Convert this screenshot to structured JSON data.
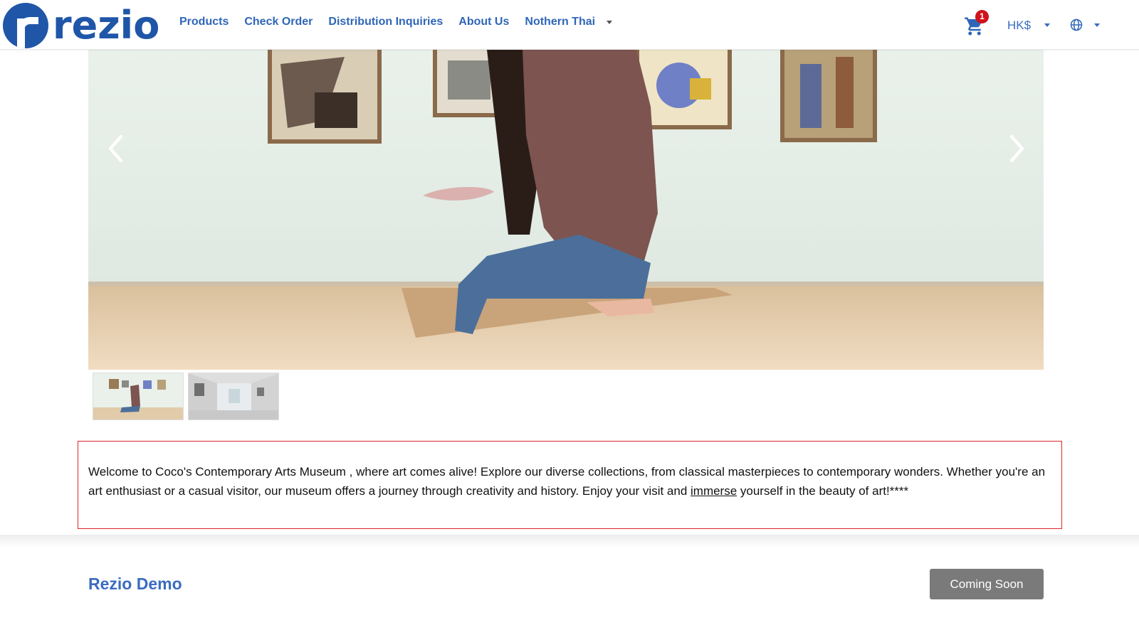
{
  "brand": {
    "name": "rezio",
    "color": "#1f56a8"
  },
  "nav": {
    "items": [
      {
        "label": "Products"
      },
      {
        "label": "Check Order"
      },
      {
        "label": "Distribution Inquiries"
      },
      {
        "label": "About Us"
      },
      {
        "label": "Nothern Thai"
      }
    ]
  },
  "header": {
    "cart_icon": "cart-icon",
    "cart_count": "1",
    "currency": "HK$",
    "language_icon": "globe-icon"
  },
  "gallery": {
    "active_index": 0,
    "thumbnail_count": 2
  },
  "description": {
    "text_before": "Welcome to Coco's Contemporary Arts Museum , where art comes alive! Explore our diverse collections, from classical masterpieces to contemporary wonders. Whether you're an art enthusiast or a casual visitor, our museum offers a journey through creativity and history. Enjoy your visit and ",
    "link_text": "immerse",
    "text_after": " yourself in the beauty of art!****"
  },
  "footer": {
    "title": "Rezio Demo",
    "button_label": "Coming Soon"
  },
  "colors": {
    "accent": "#2f66b8",
    "badge": "#d0121b",
    "highlight_border": "#e0262a",
    "button_bg": "#7a7a7a"
  }
}
